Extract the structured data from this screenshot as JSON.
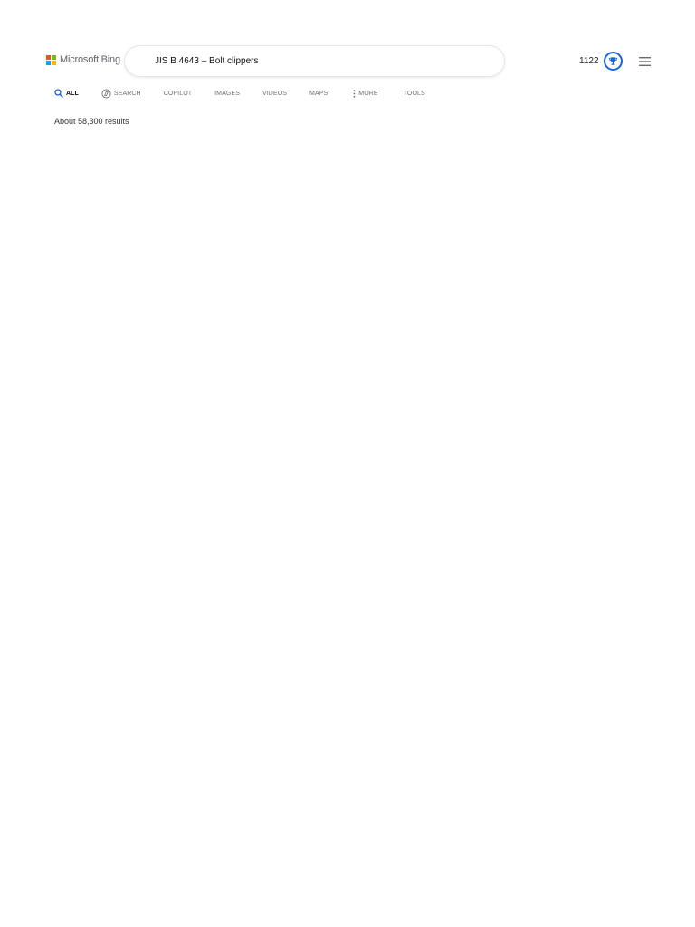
{
  "brand": {
    "logo_text": "Microsoft Bing",
    "square_colors": [
      "#f25022",
      "#7fba00",
      "#00a4ef",
      "#ffb900"
    ]
  },
  "search": {
    "query": "JIS B 4643 – Bolt clippers"
  },
  "rewards": {
    "points": "1122",
    "icon": "trophy-icon",
    "accent": "#1a63d6"
  },
  "menu": {
    "icon": "hamburger-menu-icon"
  },
  "tabs": [
    {
      "label": "ALL",
      "icon": "search-icon",
      "active": true
    },
    {
      "label": "SEARCH",
      "icon": "copilot-search-icon",
      "active": false
    },
    {
      "label": "COPILOT",
      "active": false
    },
    {
      "label": "IMAGES",
      "active": false
    },
    {
      "label": "VIDEOS",
      "active": false
    },
    {
      "label": "MAPS",
      "active": false
    },
    {
      "label": "MORE",
      "icon": "more-vertical-icon",
      "active": false
    },
    {
      "label": "TOOLS",
      "active": false
    }
  ],
  "results": {
    "count_text": "About 58,300 results"
  }
}
